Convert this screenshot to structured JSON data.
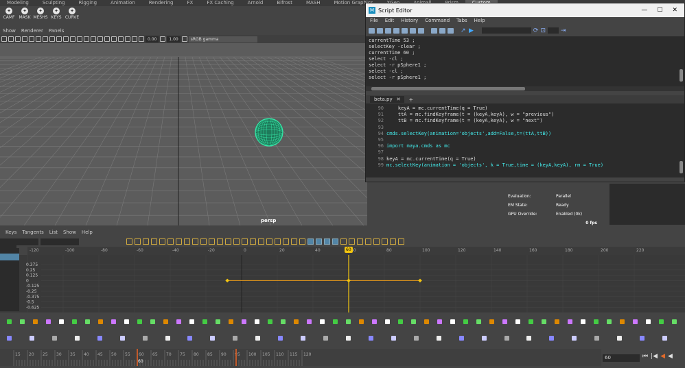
{
  "shelf": {
    "tabs": [
      "Modeling",
      "Sculpting",
      "Rigging",
      "Animation",
      "Rendering",
      "FX",
      "FX Caching",
      "Arnold",
      "Bifrost",
      "MASH",
      "Motion Graphics",
      "XGen",
      "Animall",
      "Prism",
      "Custom"
    ],
    "active_tab": "Custom",
    "items": [
      "CAMF",
      "MASK",
      "MESHS",
      "KEYS",
      "CURVE"
    ]
  },
  "viewport": {
    "menu": [
      "Show",
      "Renderer",
      "Panels"
    ],
    "exposure": "0.00",
    "gamma": "1.00",
    "color_space": "sRGB gamma",
    "camera_label": "persp"
  },
  "script_editor": {
    "title": "Script Editor",
    "menu": [
      "File",
      "Edit",
      "History",
      "Command",
      "Tabs",
      "Help"
    ],
    "history_lines": [
      "currentTime 53 ;",
      "selectKey -clear ;",
      "currentTime 60 ;",
      "select -cl  ;",
      "select -r pSphere1 ;",
      "select -cl  ;",
      "select -r pSphere1 ;"
    ],
    "tabs": [
      "beta.py"
    ],
    "line_numbers": [
      "90",
      "91",
      "92",
      "93",
      "94",
      "95",
      "96",
      "97",
      "98",
      "99"
    ],
    "code_lines": [
      "    keyA = mc.currentTime(q = True)",
      "    ttA = mc.findKeyframe(t = (keyA,keyA), w = \"previous\")",
      "    ttB = mc.findKeyframe(t = (keyA,keyA), w = \"next\")",
      "",
      "cmds.selectKey(animation='objects',add=False,t=(ttA,ttB))",
      "",
      "import maya.cmds as mc",
      "",
      "keyA = mc.currentTime(q = True)",
      "mc.selectKey(animation = 'objects', k = True,time = (keyA,keyA), rm = True)"
    ]
  },
  "hud": {
    "rows": [
      {
        "label": "Evaluation:",
        "value": "Parallel"
      },
      {
        "label": "EM State:",
        "value": "Ready"
      },
      {
        "label": "GPU Override:",
        "value": "Enabled (0k)"
      }
    ],
    "fps": "0 fps"
  },
  "graph_editor": {
    "menu": [
      "Keys",
      "Tangents",
      "List",
      "Show",
      "Help"
    ],
    "ruler": [
      "-120",
      "-100",
      "-80",
      "-60",
      "-40",
      "-20",
      "0",
      "20",
      "40",
      "60",
      "80",
      "100",
      "120",
      "140",
      "160",
      "180",
      "200",
      "220"
    ],
    "current_frame": "60",
    "y_labels": [
      "0.375",
      "0.25",
      "0.125",
      "0",
      "-0.125",
      "-0.25",
      "-0.375",
      "-0.5",
      "-0.625"
    ],
    "curve": {
      "keys": [
        -8,
        60,
        100
      ],
      "value": 0
    }
  },
  "timeline": {
    "ticks": [
      "15",
      "20",
      "25",
      "30",
      "35",
      "40",
      "45",
      "50",
      "55",
      "60",
      "65",
      "70",
      "75",
      "80",
      "85",
      "90",
      "95",
      "100",
      "105",
      "110",
      "115",
      "120"
    ],
    "current_frame": "60",
    "frame_field": "60"
  },
  "colors": {
    "accent": "#f2c511",
    "key_curve": "#e89a1a",
    "sphere": "#35e8a8"
  }
}
